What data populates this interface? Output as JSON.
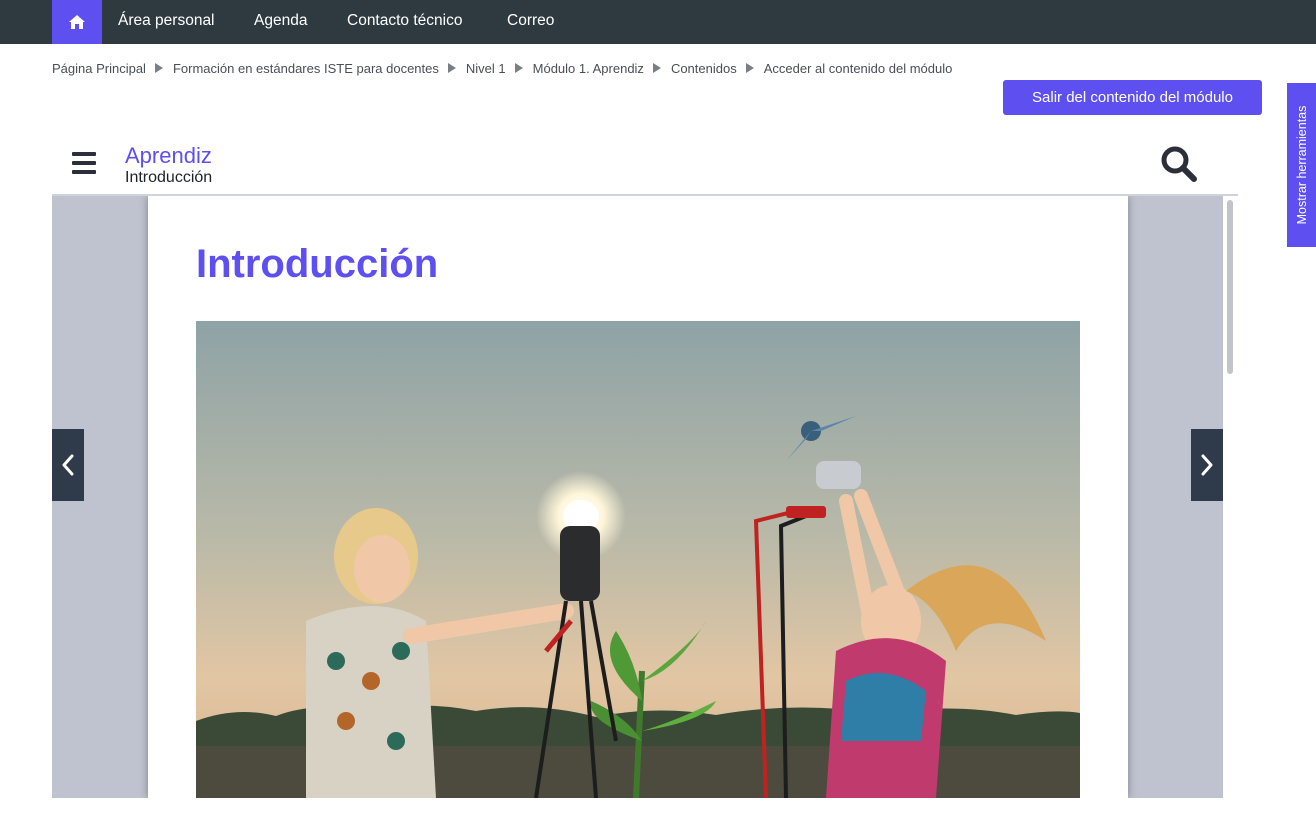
{
  "topnav": {
    "home_icon": "home-icon",
    "links": [
      "Área personal",
      "Agenda",
      "Contacto técnico",
      "Correo"
    ]
  },
  "breadcrumb": [
    "Página Principal",
    "Formación en estándares ISTE para docentes",
    "Nivel 1",
    "Módulo 1. Aprendiz",
    "Contenidos",
    "Acceder al contenido del módulo"
  ],
  "exit_button": "Salir del contenido del módulo",
  "tools_tab": "Mostrar herramientas",
  "module_header": {
    "title": "Aprendiz",
    "subtitle": "Introducción",
    "menu_icon": "hamburger-menu-icon",
    "search_icon": "search-icon"
  },
  "page": {
    "title": "Introducción",
    "hero_image": "photo of two children in a field at dusk, one holding a glowing light bulb, the other holding a small wind turbine, connected by cables"
  },
  "navigation": {
    "prev_icon": "chevron-left-icon",
    "next_icon": "chevron-right-icon"
  },
  "colors": {
    "accent": "#5e4ff0",
    "topnav_bg": "#2f3a40",
    "reader_bg": "#bfc3cf",
    "arrow_bg": "#2f3a4a"
  }
}
